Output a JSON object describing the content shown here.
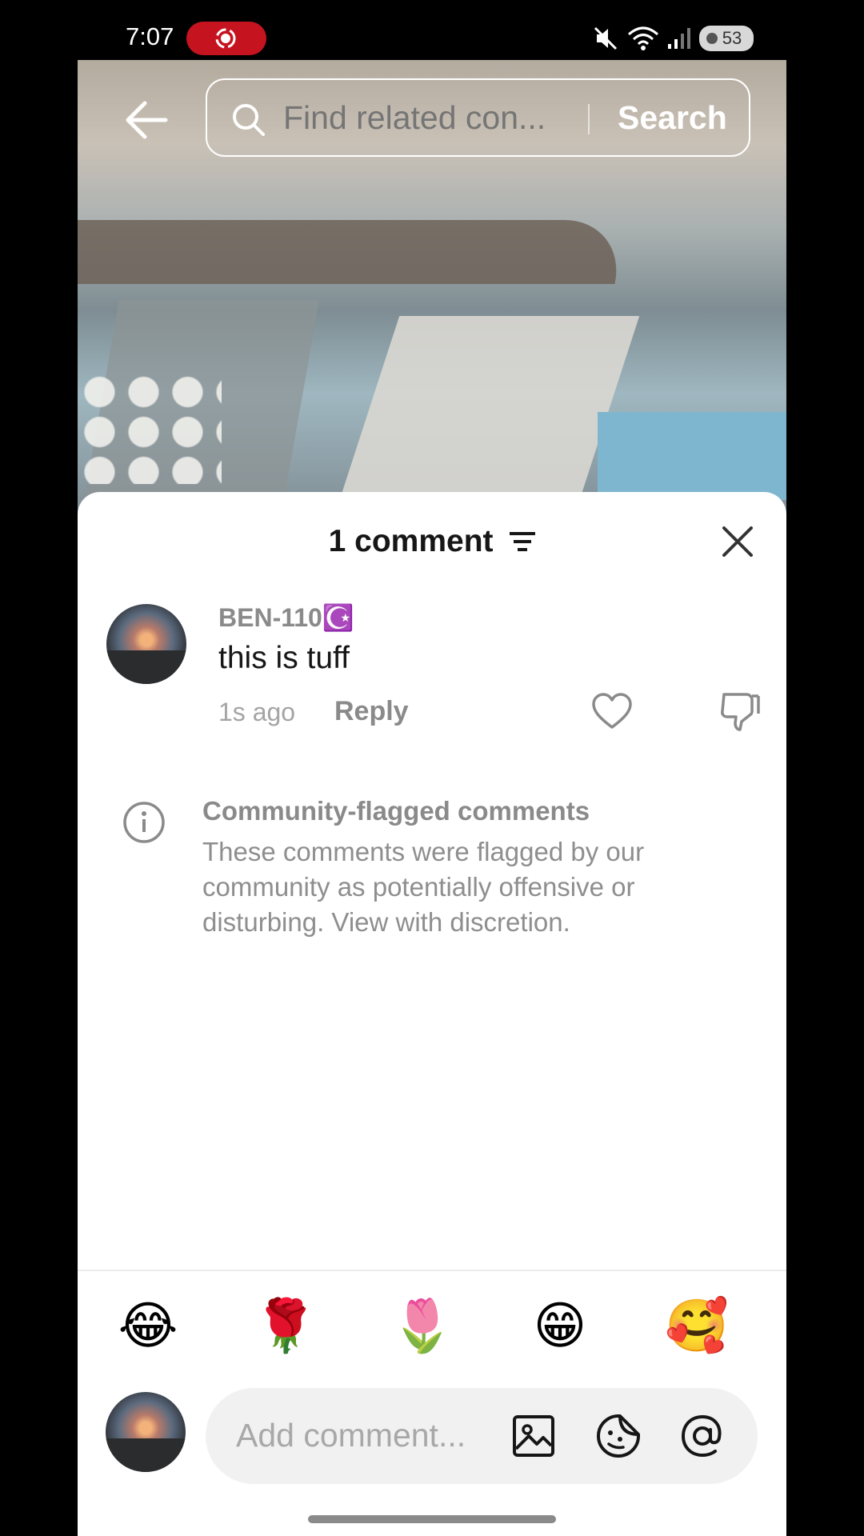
{
  "status_bar": {
    "time": "7:07",
    "battery": "53",
    "icons": [
      "screen-record-icon",
      "mute-icon",
      "wifi-icon",
      "signal-icon",
      "battery-icon"
    ]
  },
  "search": {
    "placeholder": "Find related con...",
    "button_label": "Search"
  },
  "comments_sheet": {
    "title": "1 comment",
    "comments": [
      {
        "username": "BEN-110☪️",
        "text": "this is tuff",
        "time": "1s ago",
        "reply_label": "Reply"
      }
    ],
    "flag_notice": {
      "title": "Community-flagged comments",
      "body": "These comments were flagged by our community as potentially offensive or disturbing. View with discretion."
    }
  },
  "quick_emojis": [
    "😂",
    "🌹",
    "🌷",
    "😁",
    "🥰"
  ],
  "composer": {
    "placeholder": "Add comment..."
  },
  "colors": {
    "record_red": "#c5141f",
    "sheet_bg": "#ffffff",
    "muted_text": "#8a8a8a",
    "input_bg": "#f1f1f2"
  }
}
